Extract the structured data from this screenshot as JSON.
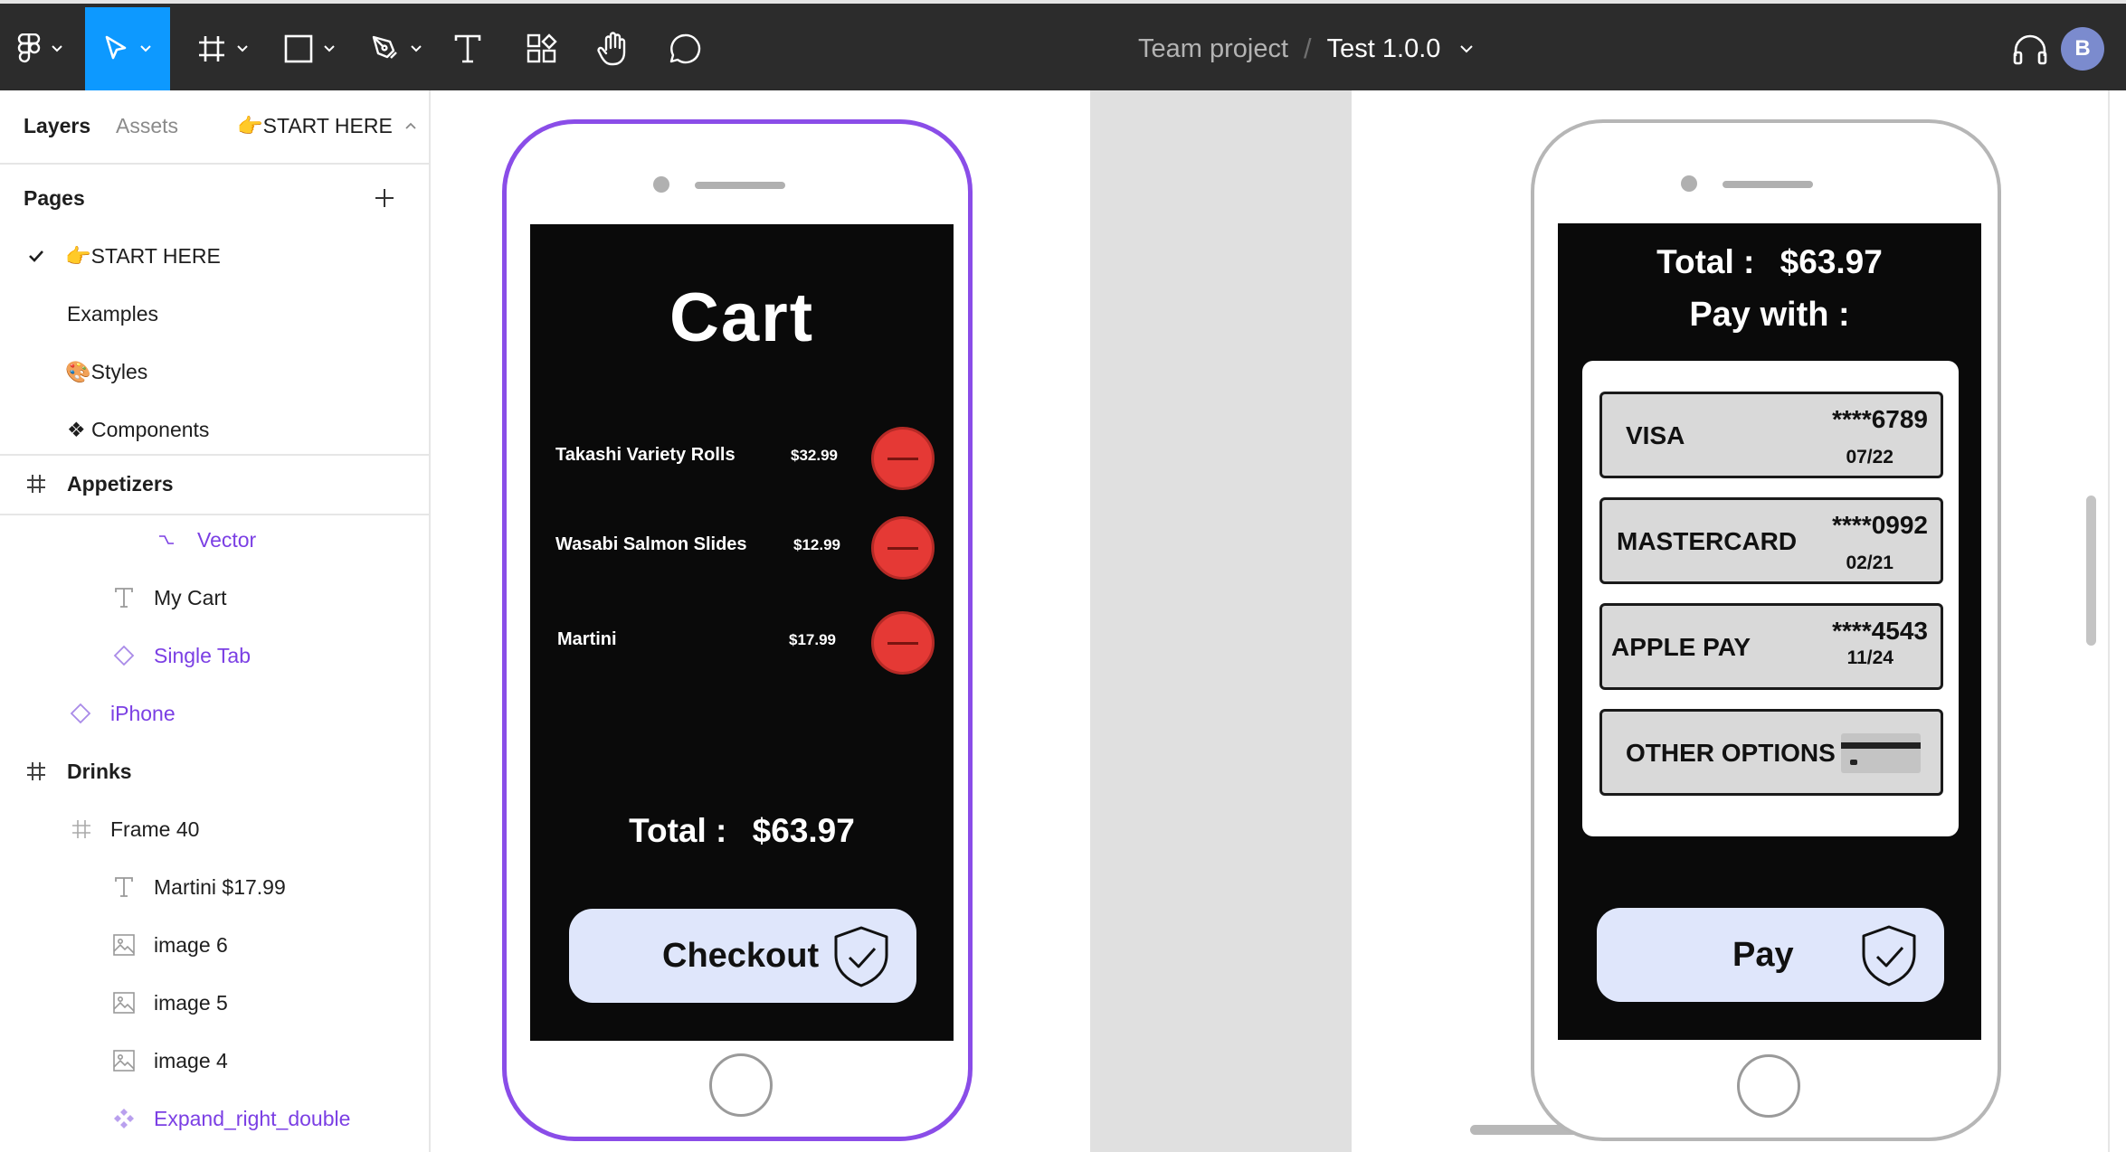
{
  "toolbar": {
    "icons": [
      "figma-menu-icon",
      "move-tool-icon",
      "frame-tool-icon",
      "shape-tool-icon",
      "pen-tool-icon",
      "text-tool-icon",
      "resources-icon",
      "hand-tool-icon",
      "comment-icon"
    ],
    "active_tool": "move-tool-icon",
    "accent": "#0d99ff",
    "breadcrumb": {
      "team": "Team project",
      "separator": "/",
      "file": "Test 1.0.0"
    },
    "avatar_initial": "B"
  },
  "left_panel": {
    "tabs": {
      "layers": "Layers",
      "assets": "Assets",
      "current_page": "👉START HERE"
    },
    "pages_header": "Pages",
    "pages": [
      {
        "label": "👉START HERE",
        "selected": true
      },
      {
        "label": "Examples",
        "selected": false
      },
      {
        "label": "🎨Styles",
        "selected": false
      },
      {
        "label": "❖ Components",
        "selected": false
      }
    ],
    "layers": [
      {
        "label": "Appetizers",
        "icon": "frame-icon"
      },
      {
        "label": "Vector",
        "icon": "vector-icon"
      },
      {
        "label": "My Cart",
        "icon": "text-layer-icon"
      },
      {
        "label": "Single Tab",
        "icon": "instance-icon"
      },
      {
        "label": "iPhone",
        "icon": "instance-icon"
      },
      {
        "label": "Drinks",
        "icon": "frame-icon"
      },
      {
        "label": "Frame 40",
        "icon": "frame-icon"
      },
      {
        "label": "Martini $17.99",
        "icon": "text-layer-icon"
      },
      {
        "label": "image 6",
        "icon": "image-icon"
      },
      {
        "label": "image 5",
        "icon": "image-icon"
      },
      {
        "label": "image 4",
        "icon": "image-icon"
      },
      {
        "label": "Expand_right_double",
        "icon": "component-icon"
      }
    ]
  },
  "cart_screen": {
    "title": "Cart",
    "items": [
      {
        "name": "Takashi Variety Rolls",
        "price": "$32.99"
      },
      {
        "name": "Wasabi Salmon Slides",
        "price": "$12.99"
      },
      {
        "name": "Martini",
        "price": "$17.99"
      }
    ],
    "total_label": "Total :",
    "total_value": "$63.97",
    "checkout_label": "Checkout"
  },
  "pay_screen": {
    "total_label": "Total :",
    "total_value": "$63.97",
    "pay_with": "Pay with :",
    "methods": [
      {
        "name": "VISA",
        "number": "****6789",
        "expiry": "07/22"
      },
      {
        "name": "MASTERCARD",
        "number": "****0992",
        "expiry": "02/21"
      },
      {
        "name": "APPLE PAY",
        "number": "****4543",
        "expiry": "11/24"
      },
      {
        "name": "OTHER OPTIONS"
      }
    ],
    "pay_label": "Pay"
  },
  "colors": {
    "selection": "#8a4de8",
    "remove_button": "#e53935",
    "cta_background": "#dfe6fb",
    "layer_instance": "#7b3fe4"
  }
}
